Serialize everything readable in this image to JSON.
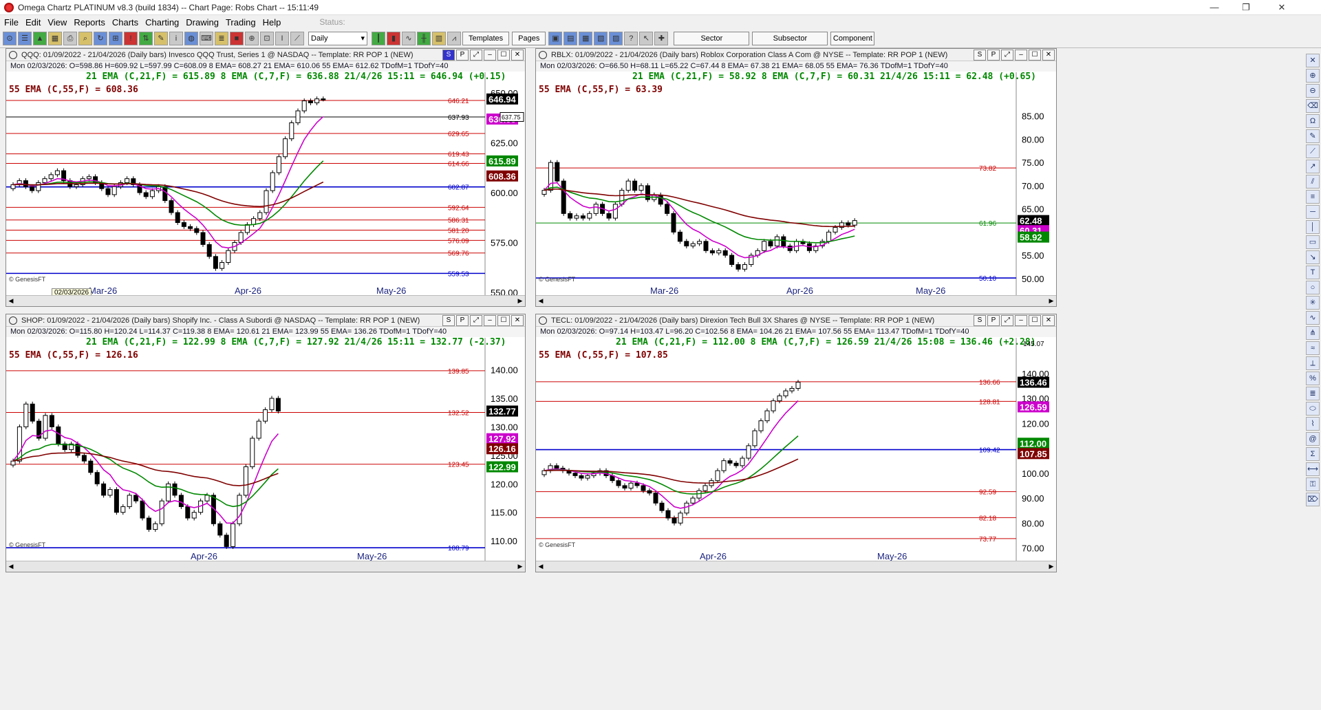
{
  "window": {
    "title": "Omega Chartz PLATINUM v8.3 (build 1834)  --  Chart Page: Robs Chart  --  15:11:49",
    "minimize": "—",
    "restore": "❐",
    "close": "✕"
  },
  "menu": {
    "items": [
      "File",
      "Edit",
      "View",
      "Reports",
      "Charts",
      "Charting",
      "Drawing",
      "Trading",
      "Help"
    ],
    "status_label": "Status:"
  },
  "toolbar": {
    "period_select": "Daily",
    "templates": "Templates",
    "pages": "Pages",
    "sector": "Sector",
    "subsector": "Subsector",
    "component": "Component"
  },
  "charts": [
    {
      "header": "QQQ:  01/09/2022 - 21/04/2026  (Daily bars)   Invesco QQQ Trust, Series 1 @ NASDAQ  --  Template: RR POP 1 (NEW)",
      "ctrls": [
        "S",
        "P",
        "⤢"
      ],
      "ohlc": "Mon  02/03/2026:  O=598.86  H=609.92  L=597.99  C=608.09  8 EMA= 608.27  21 EMA= 610.06  55 EMA= 612.62  TDofM=1  TDofY=40",
      "ema_line1": "21 EMA (C,21,F) = 615.89  8 EMA (C,7,F) = 636.88  21/4/26 15:11 = 646.94 (+0.15)",
      "ema_line2": "55 EMA (C,55,F) = 608.36",
      "source": "© GenesisFT",
      "date_tooltip": "02/03/2026"
    },
    {
      "header": "RBLX:  01/09/2022 - 21/04/2026  (Daily bars)   Roblox Corporation Class A Com @ NYSE  --  Template: RR POP 1 (NEW)",
      "ctrls": [
        "S",
        "P",
        "⤢"
      ],
      "ohlc": "Mon  02/03/2026:  O=66.50  H=68.11  L=65.22  C=67.44  8 EMA= 67.38  21 EMA= 68.05  55 EMA= 76.36  TDofM=1  TDofY=40",
      "ema_line1": "21 EMA (C,21,F) = 58.92  8 EMA (C,7,F) = 60.31  21/4/26 15:11 = 62.48 (+0.65)",
      "ema_line2": "55 EMA (C,55,F) = 63.39",
      "source": "© GenesisFT"
    },
    {
      "header": "SHOP:  01/09/2022 - 21/04/2026  (Daily bars)   Shopify Inc. - Class A Subordi @ NASDAQ  --  Template: RR POP 1 (NEW)",
      "ctrls": [
        "S",
        "P",
        "⤢"
      ],
      "ohlc": "Mon  02/03/2026:  O=115.80  H=120.24  L=114.37  C=119.38  8 EMA= 120.61  21 EMA= 123.99  55 EMA= 136.26  TDofM=1  TDofY=40",
      "ema_line1": "21 EMA (C,21,F) = 122.99  8 EMA (C,7,F) = 127.92  21/4/26 15:11 = 132.77 (-2.37)",
      "ema_line2": "55 EMA (C,55,F) = 126.16",
      "source": "© GenesisFT"
    },
    {
      "header": "TECL:  01/09/2022 - 21/04/2026  (Daily bars)   Direxion Tech Bull 3X Shares @ NYSE  --  Template: RR POP 1 (NEW)",
      "ctrls": [
        "S",
        "P",
        "⤢"
      ],
      "ohlc": "Mon  02/03/2026:  O=97.14  H=103.47  L=96.20  C=102.56  8 EMA= 104.26  21 EMA= 107.56  55 EMA= 113.47  TDofM=1  TDofY=40",
      "ema_line1": "21 EMA (C,21,F) = 112.00  8 EMA (C,7,F) = 126.59  21/4/26 15:08 = 136.46 (+2.28)",
      "ema_line2": "55 EMA (C,55,F) = 107.85",
      "source": "© GenesisFT"
    }
  ],
  "chart_data": [
    {
      "type": "candlestick",
      "symbol": "QQQ",
      "ylim": [
        550,
        650
      ],
      "yticks": [
        550,
        575,
        600,
        625,
        650
      ],
      "ytick_labels": [
        "550.00",
        "575.00",
        "600.00",
        "625.00",
        "650.00"
      ],
      "xlabels": [
        "Mar-26",
        "Apr-26",
        "May-26"
      ],
      "levels": [
        {
          "v": 646.21,
          "label": "646.21",
          "color": "#cc0000"
        },
        {
          "v": 637.93,
          "label": "637.93",
          "color": "#000000"
        },
        {
          "v": 629.65,
          "label": "629.65",
          "color": "#cc0000"
        },
        {
          "v": 619.43,
          "label": "619.43",
          "color": "#cc0000"
        },
        {
          "v": 614.66,
          "label": "614.66",
          "color": "#cc0000"
        },
        {
          "v": 602.87,
          "label": "602.87",
          "color": "#0000cc"
        },
        {
          "v": 592.64,
          "label": "592.64",
          "color": "#cc0000"
        },
        {
          "v": 586.31,
          "label": "586.31",
          "color": "#cc0000"
        },
        {
          "v": 581.2,
          "label": "581.20",
          "color": "#cc0000"
        },
        {
          "v": 576.09,
          "label": "576.09",
          "color": "#cc0000"
        },
        {
          "v": 569.76,
          "label": "569.76",
          "color": "#cc0000"
        },
        {
          "v": 559.53,
          "label": "559.53",
          "color": "#0000cc"
        }
      ],
      "price_tags": [
        {
          "v": 646.94,
          "label": "646.94",
          "bg": "#000000"
        },
        {
          "v": 636.88,
          "label": "636.88",
          "bg": "#cc00cc"
        },
        {
          "v": 615.89,
          "label": "615.89",
          "bg": "#008800"
        },
        {
          "v": 608.36,
          "label": "608.36",
          "bg": "#800000"
        }
      ],
      "cursor_tag": "637.75",
      "ohlc_closes": [
        604,
        606,
        603,
        601,
        605,
        607,
        609,
        611,
        606,
        603,
        604,
        607,
        608,
        605,
        602,
        599,
        603,
        605,
        607,
        604,
        600,
        598,
        601,
        603,
        596,
        590,
        585,
        583,
        582,
        580,
        574,
        568,
        562,
        565,
        571,
        575,
        580,
        584,
        587,
        590,
        601,
        610,
        618,
        627,
        635,
        641,
        646,
        645,
        647,
        646.94
      ]
    },
    {
      "type": "candlestick",
      "symbol": "RBLX",
      "ylim": [
        47,
        90
      ],
      "yticks": [
        50,
        55,
        60,
        65,
        70,
        75,
        80,
        85
      ],
      "ytick_labels": [
        "50.00",
        "55.00",
        "60.00",
        "65.00",
        "70.00",
        "75.00",
        "80.00",
        "85.00"
      ],
      "xlabels": [
        "Mar-26",
        "Apr-26",
        "May-26"
      ],
      "levels": [
        {
          "v": 73.82,
          "label": "73.82",
          "color": "#cc0000"
        },
        {
          "v": 61.96,
          "label": "61.96",
          "color": "#008800"
        },
        {
          "v": 50.1,
          "label": "50.10",
          "color": "#0000cc"
        }
      ],
      "price_tags": [
        {
          "v": 62.48,
          "label": "62.48",
          "bg": "#000000"
        },
        {
          "v": 60.31,
          "label": "60.31",
          "bg": "#cc00cc"
        },
        {
          "v": 58.92,
          "label": "58.92",
          "bg": "#008800"
        }
      ],
      "ohlc_closes": [
        69,
        75,
        71,
        64,
        63,
        63.5,
        63,
        64,
        66,
        64,
        63,
        66,
        69,
        71,
        69,
        70,
        67,
        68,
        66,
        64,
        60,
        58,
        57,
        57.5,
        58,
        56,
        55.5,
        56,
        55,
        53,
        52,
        53,
        55,
        56,
        58,
        57,
        59,
        57,
        56,
        58,
        57.5,
        56,
        57,
        58,
        60,
        61,
        62,
        61.5,
        62.48
      ]
    },
    {
      "type": "candlestick",
      "symbol": "SHOP",
      "ylim": [
        107,
        142
      ],
      "yticks": [
        110,
        115,
        120,
        125,
        130,
        135,
        140
      ],
      "ytick_labels": [
        "110.00",
        "115.00",
        "120.00",
        "125.00",
        "130.00",
        "135.00",
        "140.00"
      ],
      "xlabels": [
        "Apr-26",
        "May-26"
      ],
      "levels": [
        {
          "v": 139.85,
          "label": "139.85",
          "color": "#cc0000"
        },
        {
          "v": 132.52,
          "label": "132.52",
          "color": "#cc0000"
        },
        {
          "v": 123.45,
          "label": "123.45",
          "color": "#cc0000"
        },
        {
          "v": 108.79,
          "label": "108.79",
          "color": "#0000cc"
        }
      ],
      "price_tags": [
        {
          "v": 132.77,
          "label": "132.77",
          "bg": "#000000"
        },
        {
          "v": 127.92,
          "label": "127.92",
          "bg": "#cc00cc"
        },
        {
          "v": 126.16,
          "label": "126.16",
          "bg": "#800000"
        },
        {
          "v": 122.99,
          "label": "122.99",
          "bg": "#008800"
        }
      ],
      "ohlc_closes": [
        124,
        130,
        134,
        131,
        128,
        132,
        130,
        127,
        126,
        127,
        125,
        124,
        122,
        120,
        118,
        119,
        115,
        116,
        118,
        117,
        114,
        112,
        113,
        117,
        120,
        118,
        116,
        114,
        115,
        117,
        118,
        113,
        111,
        109,
        113,
        118,
        123,
        128,
        131,
        133,
        135,
        132.77
      ]
    },
    {
      "type": "candlestick",
      "symbol": "TECL",
      "ylim": [
        66,
        146
      ],
      "yticks": [
        70,
        80,
        90,
        100,
        110,
        120,
        130,
        140
      ],
      "ytick_labels": [
        "70.00",
        "80.00",
        "90.00",
        "100.00",
        "110.00",
        "120.00",
        "130.00",
        "140.00"
      ],
      "xlabels": [
        "Apr-26",
        "May-26"
      ],
      "top_label": "145.07",
      "levels": [
        {
          "v": 136.66,
          "label": "136.66",
          "color": "#cc0000"
        },
        {
          "v": 128.81,
          "label": "128.81",
          "color": "#cc0000"
        },
        {
          "v": 109.42,
          "label": "109.42",
          "color": "#0000cc"
        },
        {
          "v": 92.59,
          "label": "92.59",
          "color": "#cc0000"
        },
        {
          "v": 82.18,
          "label": "82.18",
          "color": "#cc0000"
        },
        {
          "v": 73.77,
          "label": "73.77",
          "color": "#cc0000"
        }
      ],
      "price_tags": [
        {
          "v": 136.46,
          "label": "136.46",
          "bg": "#000000"
        },
        {
          "v": 126.59,
          "label": "126.59",
          "bg": "#cc00cc"
        },
        {
          "v": 112.0,
          "label": "112.00",
          "bg": "#008800"
        },
        {
          "v": 107.85,
          "label": "107.85",
          "bg": "#800000"
        }
      ],
      "ohlc_closes": [
        101,
        103,
        102,
        101,
        100,
        99,
        98,
        99,
        100,
        101,
        99,
        97,
        95,
        94,
        96,
        95,
        93,
        92,
        88,
        85,
        82,
        80,
        84,
        88,
        90,
        93,
        95,
        97,
        101,
        105,
        104,
        103,
        106,
        111,
        117,
        121,
        125,
        129,
        131,
        133,
        134,
        136.46
      ]
    }
  ]
}
